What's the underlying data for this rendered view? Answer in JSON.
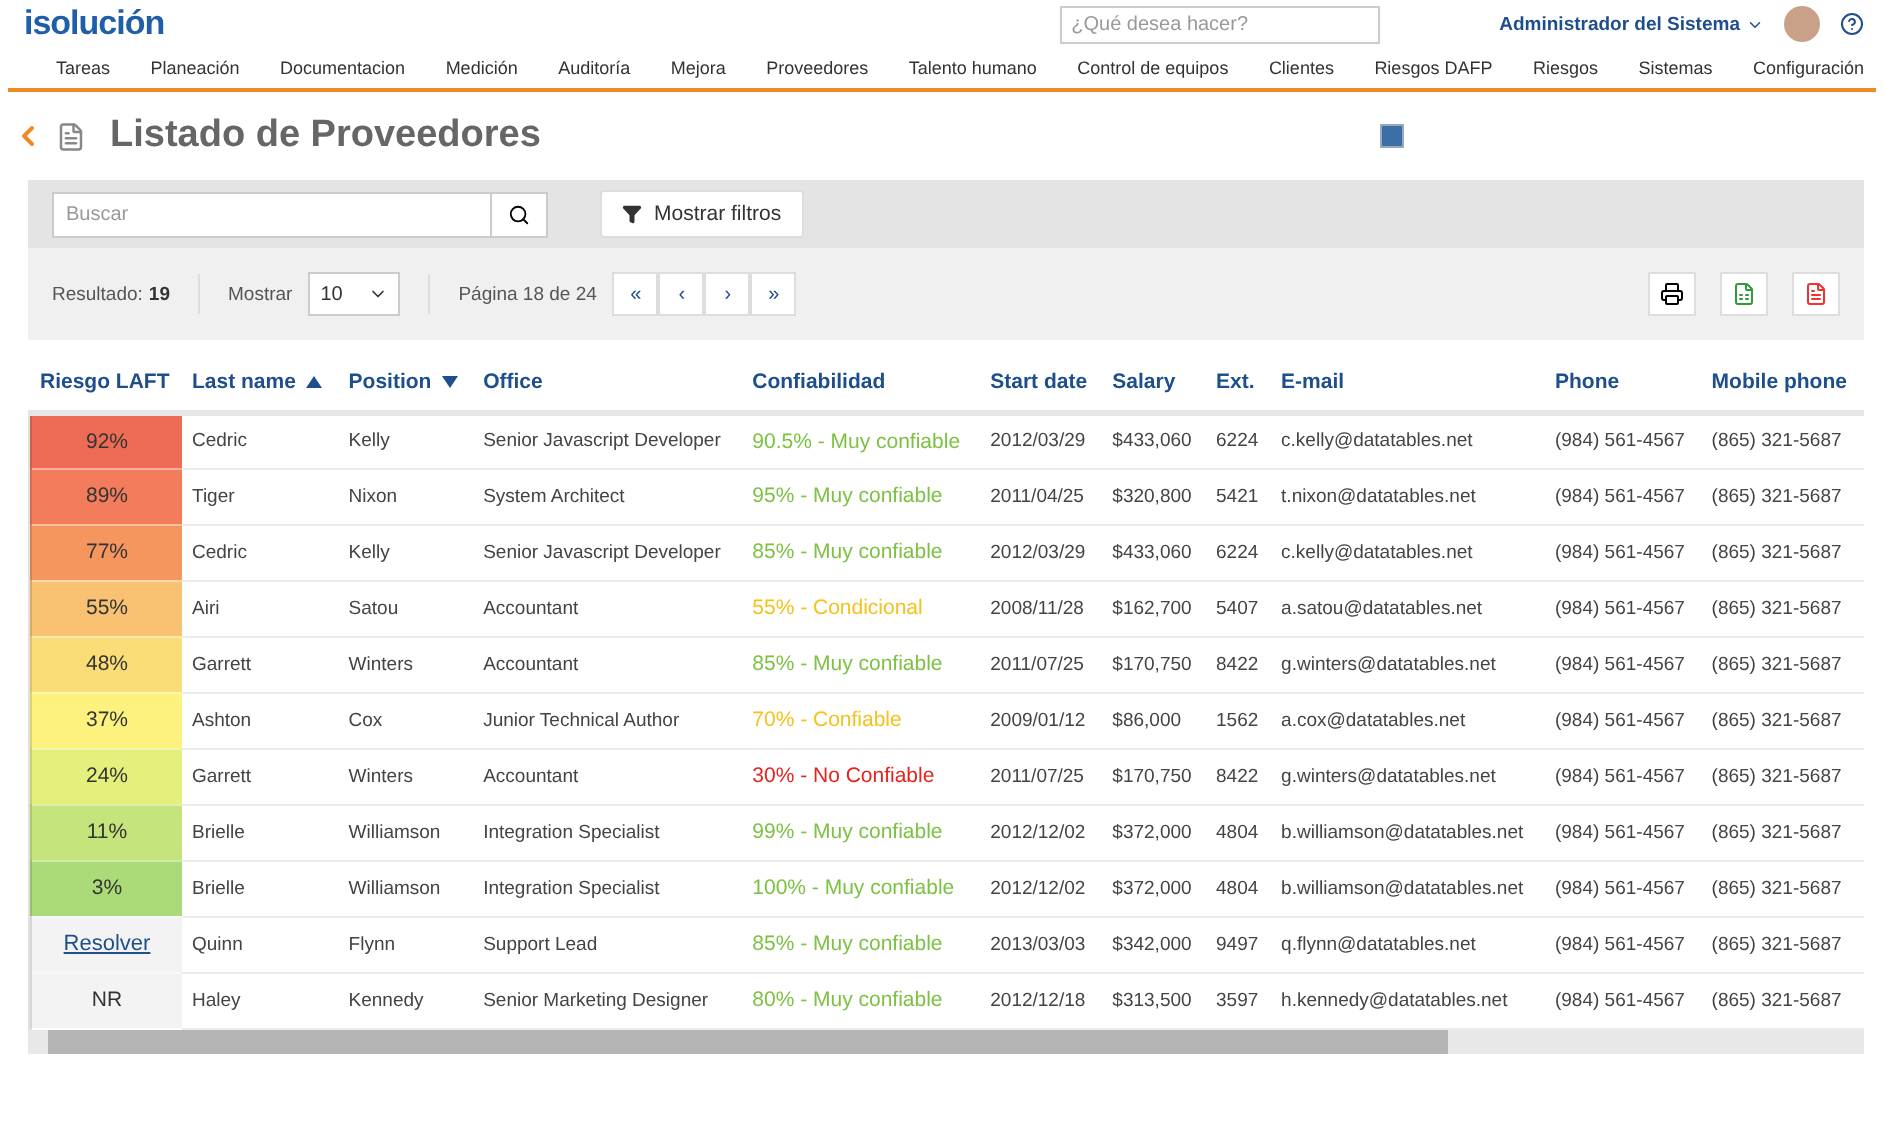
{
  "header": {
    "logo": "isolución",
    "search": {
      "placeholder": "¿Qué desea hacer?"
    },
    "user": "Administrador del Sistema"
  },
  "nav": [
    {
      "label": "Tareas",
      "selected": false
    },
    {
      "label": "Planeación",
      "selected": false
    },
    {
      "label": "Documentacion",
      "selected": false
    },
    {
      "label": "Medición",
      "selected": false
    },
    {
      "label": "Auditoría",
      "selected": false
    },
    {
      "label": "Mejora",
      "selected": false
    },
    {
      "label": "Proveedores",
      "selected": false
    },
    {
      "label": "Talento humano",
      "selected": false
    },
    {
      "label": "Control de equipos",
      "selected": false
    },
    {
      "label": "Clientes",
      "selected": false
    },
    {
      "label": "Riesgos DAFP",
      "selected": false
    },
    {
      "label": "Riesgos",
      "selected": false
    },
    {
      "label": "Sistemas",
      "selected": false
    },
    {
      "label": "Configuración",
      "selected": false
    }
  ],
  "page_title": "Listado de Proveedores",
  "toolbar": {
    "search": {
      "placeholder": "Buscar"
    },
    "filters_button": "Mostrar filtros",
    "result_label": "Resultado:",
    "result_count": "19",
    "show_label": "Mostrar",
    "page_size": "10",
    "page_info": "Página 18 de 24",
    "pager": [
      "«",
      "‹",
      "›",
      "»"
    ]
  },
  "table": {
    "columns": [
      {
        "label": "Riesgo LAFT",
        "sorted_ascending": false,
        "sorted_descending": false
      },
      {
        "label": "Last name",
        "sorted_ascending": true,
        "sorted_descending": false
      },
      {
        "label": "Position",
        "sorted_ascending": false,
        "sorted_descending": true
      },
      {
        "label": "Office",
        "sorted_ascending": false,
        "sorted_descending": false
      },
      {
        "label": "Confiabilidad",
        "sorted_ascending": false,
        "sorted_descending": false
      },
      {
        "label": "Start date",
        "sorted_ascending": false,
        "sorted_descending": false
      },
      {
        "label": "Salary",
        "sorted_ascending": false,
        "sorted_descending": false
      },
      {
        "label": "Ext.",
        "sorted_ascending": false,
        "sorted_descending": false
      },
      {
        "label": "E-mail",
        "sorted_ascending": false,
        "sorted_descending": false
      },
      {
        "label": "Phone",
        "sorted_ascending": false,
        "sorted_descending": false
      },
      {
        "label": "Mobile phone",
        "sorted_ascending": false,
        "sorted_descending": false
      }
    ],
    "rows": [
      [
        {
          "text": "92%",
          "kind": "value",
          "color": "#ee6c55"
        },
        "Cedric",
        "Kelly",
        "Senior Javascript Developer",
        {
          "text": "90.5% - Muy confiable",
          "color": "#7cc242"
        },
        "2012/03/29",
        "$433,060",
        "6224",
        "c.kelly@datatables.net",
        "(984) 561-4567",
        "(865) 321-5687"
      ],
      [
        {
          "text": "89%",
          "kind": "value",
          "color": "#f27c5b"
        },
        "Tiger",
        "Nixon",
        "System Architect",
        {
          "text": "95% - Muy confiable",
          "color": "#7cc242"
        },
        "2011/04/25",
        "$320,800",
        "5421",
        "t.nixon@datatables.net",
        "(984) 561-4567",
        "(865) 321-5687"
      ],
      [
        {
          "text": "77%",
          "kind": "value",
          "color": "#f6965f"
        },
        "Cedric",
        "Kelly",
        "Senior Javascript Developer",
        {
          "text": "85% - Muy confiable",
          "color": "#7cc242"
        },
        "2012/03/29",
        "$433,060",
        "6224",
        "c.kelly@datatables.net",
        "(984) 561-4567",
        "(865) 321-5687"
      ],
      [
        {
          "text": "55%",
          "kind": "value",
          "color": "#f9c272"
        },
        "Airi",
        "Satou",
        "Accountant",
        {
          "text": "55% - Condicional",
          "color": "#f3c21b"
        },
        "2008/11/28",
        "$162,700",
        "5407",
        "a.satou@datatables.net",
        "(984) 561-4567",
        "(865) 321-5687"
      ],
      [
        {
          "text": "48%",
          "kind": "value",
          "color": "#fbdd78"
        },
        "Garrett",
        "Winters",
        "Accountant",
        {
          "text": "85% - Muy confiable",
          "color": "#7cc242"
        },
        "2011/07/25",
        "$170,750",
        "8422",
        "g.winters@datatables.net",
        "(984) 561-4567",
        "(865) 321-5687"
      ],
      [
        {
          "text": "37%",
          "kind": "value",
          "color": "#fdf27e"
        },
        "Ashton",
        "Cox",
        "Junior Technical Author",
        {
          "text": "70% - Confiable",
          "color": "#f3c21b"
        },
        "2009/01/12",
        "$86,000",
        "1562",
        "a.cox@datatables.net",
        "(984) 561-4567",
        "(865) 321-5687"
      ],
      [
        {
          "text": "24%",
          "kind": "value",
          "color": "#e5f07c"
        },
        "Garrett",
        "Winters",
        "Accountant",
        {
          "text": "30% - No Confiable",
          "color": "#e8231f"
        },
        "2011/07/25",
        "$170,750",
        "8422",
        "g.winters@datatables.net",
        "(984) 561-4567",
        "(865) 321-5687"
      ],
      [
        {
          "text": "11%",
          "kind": "value",
          "color": "#c6e47c"
        },
        "Brielle",
        "Williamson",
        "Integration Specialist",
        {
          "text": "99% - Muy confiable",
          "color": "#7cc242"
        },
        "2012/12/02",
        "$372,000",
        "4804",
        "b.williamson@datatables.net",
        "(984) 561-4567",
        "(865) 321-5687"
      ],
      [
        {
          "text": "3%",
          "kind": "value",
          "color": "#aadb78"
        },
        "Brielle",
        "Williamson",
        "Integration Specialist",
        {
          "text": "100% - Muy confiable",
          "color": "#7cc242"
        },
        "2012/12/02",
        "$372,000",
        "4804",
        "b.williamson@datatables.net",
        "(984) 561-4567",
        "(865) 321-5687"
      ],
      [
        {
          "text": "Resolver",
          "kind": "link",
          "color": "#f3f3f3"
        },
        "Quinn",
        "Flynn",
        "Support Lead",
        {
          "text": "85% - Muy confiable",
          "color": "#7cc242"
        },
        "2013/03/03",
        "$342,000",
        "9497",
        "q.flynn@datatables.net",
        "(984) 561-4567",
        "(865) 321-5687"
      ],
      [
        {
          "text": "NR",
          "kind": "value",
          "color": "#f3f3f3"
        },
        "Haley",
        "Kennedy",
        "Senior Marketing Designer",
        {
          "text": "80% - Muy confiable",
          "color": "#7cc242"
        },
        "2012/12/18",
        "$313,500",
        "3597",
        "h.kennedy@datatables.net",
        "(984) 561-4567",
        "(865) 321-5687"
      ]
    ]
  }
}
